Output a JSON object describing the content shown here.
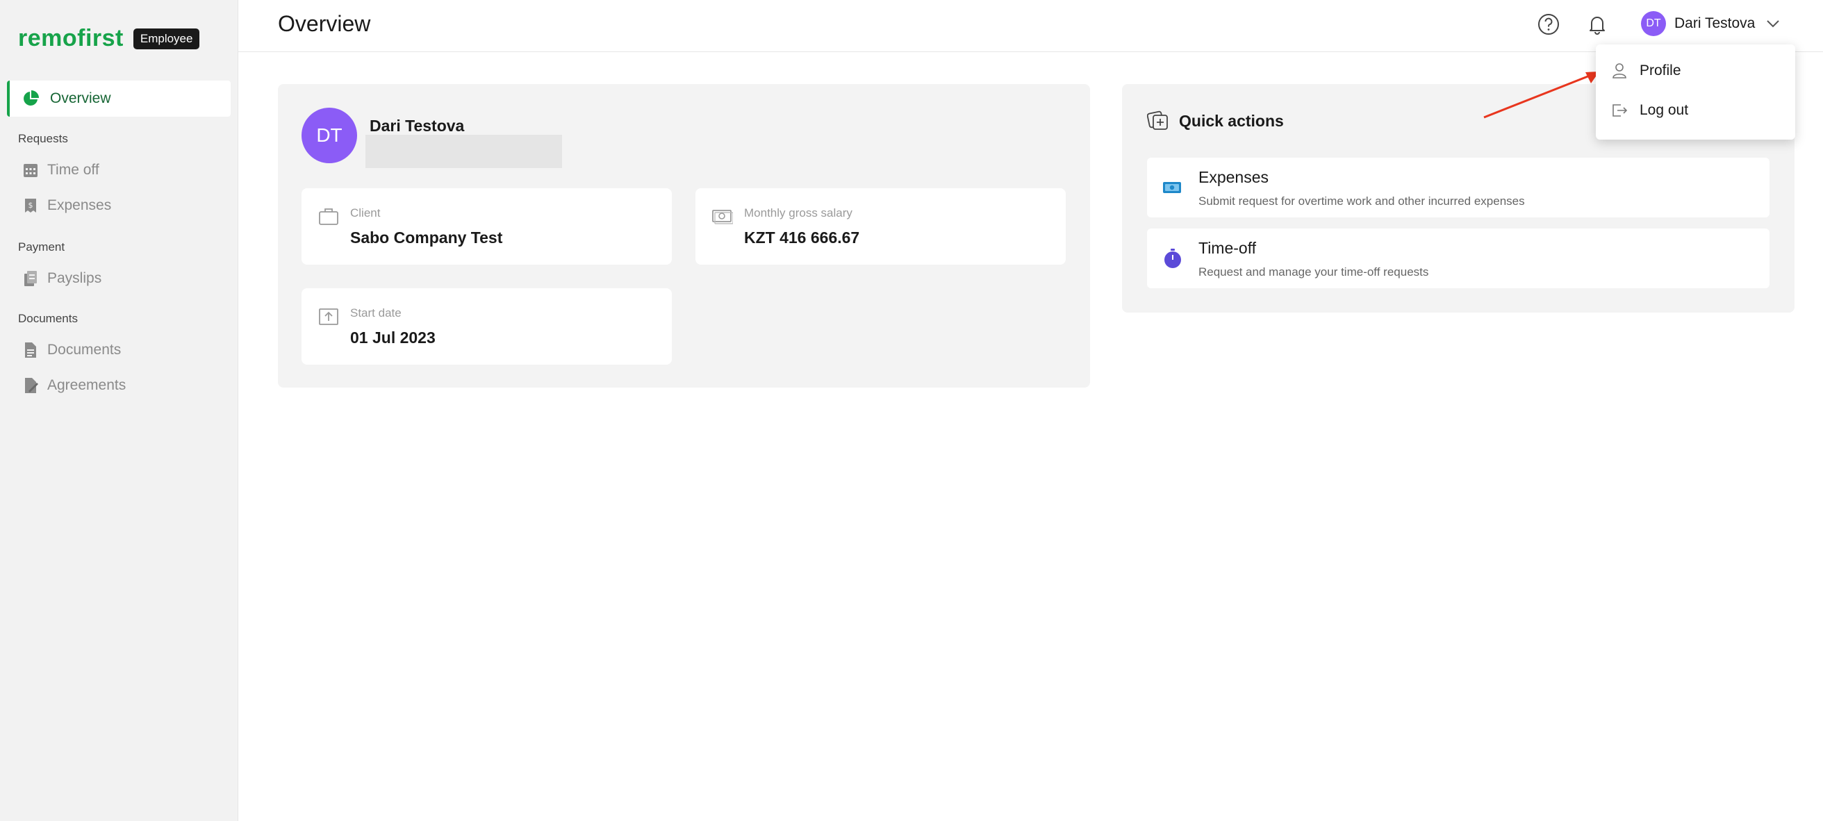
{
  "app": {
    "logo_text": "remofirst",
    "role_badge": "Employee",
    "brand_color": "#17a34a"
  },
  "sidebar": {
    "items": [
      {
        "label": "Overview",
        "icon": "pie-chart-icon",
        "active": true
      },
      {
        "section": "Requests"
      },
      {
        "label": "Time off",
        "icon": "calendar-icon"
      },
      {
        "label": "Expenses",
        "icon": "receipt-icon"
      },
      {
        "section": "Payment"
      },
      {
        "label": "Payslips",
        "icon": "payslip-icon"
      },
      {
        "section": "Documents"
      },
      {
        "label": "Documents",
        "icon": "document-icon"
      },
      {
        "label": "Agreements",
        "icon": "agreement-icon"
      }
    ]
  },
  "header": {
    "title": "Overview",
    "help_icon": "help-icon",
    "bell_icon": "bell-icon",
    "user_initials": "DT",
    "user_name": "Dari Testova",
    "avatar_color": "#8b5cf6"
  },
  "profile": {
    "initials": "DT",
    "name": "Dari Testova",
    "client_label": "Client",
    "client_value": "Sabo Company Test",
    "salary_label": "Monthly gross salary",
    "salary_value": "KZT 416 666.67",
    "start_label": "Start date",
    "start_value": "01 Jul 2023"
  },
  "quick_actions": {
    "title": "Quick actions",
    "items": [
      {
        "name": "Expenses",
        "desc": "Submit request for overtime work and other incurred expenses",
        "icon": "cash-icon"
      },
      {
        "name": "Time-off",
        "desc": "Request and manage your time-off requests",
        "icon": "stopwatch-icon"
      }
    ]
  },
  "dropdown": {
    "items": [
      {
        "label": "Profile",
        "icon": "user-icon"
      },
      {
        "label": "Log out",
        "icon": "logout-icon"
      }
    ]
  },
  "annotation": {
    "arrow_color": "#e8361e"
  }
}
